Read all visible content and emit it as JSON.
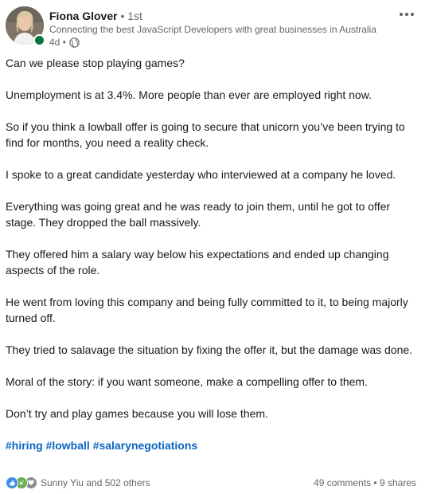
{
  "author": {
    "name": "Fiona Glover",
    "separator": "•",
    "degree": "1st",
    "headline": "Connecting the best JavaScript Developers with great businesses in Australia",
    "time": "4d •",
    "visibility_icon": "globe-icon",
    "online_status_color": "#057642"
  },
  "post": {
    "paragraphs": [
      "Can we please stop playing games?",
      "Unemployment is at 3.4%. More people than ever are employed right now.",
      "So if you think a lowball offer is going to secure that unicorn you’ve been trying to find for months, you need a reality check.",
      "I spoke to a great candidate yesterday who interviewed at a company he loved.",
      "Everything was going great and he was ready to join them, until he got to offer stage. They dropped the ball massively.",
      "They offered him a salary way below his expectations and ended up changing aspects of the role.",
      "He went from loving this company and being fully committed to it, to being majorly turned off.",
      "They tried to salavage the situation by fixing the offer it, but the damage was done.",
      "Moral of the story: if you want someone, make a compelling offer to them.",
      "Don’t try and play games because you will lose them."
    ],
    "hashtags": [
      "#hiring",
      "#lowball",
      "#salarynegotiations"
    ]
  },
  "social": {
    "reaction_icons": [
      "like-icon",
      "celebrate-icon",
      "support-icon"
    ],
    "reactions_label": "Sunny Yiu and 502 others",
    "comments": "49 comments",
    "separator": "•",
    "shares": "9 shares"
  },
  "colors": {
    "link": "#0a66c2",
    "text": "#191919",
    "muted": "#666666"
  }
}
